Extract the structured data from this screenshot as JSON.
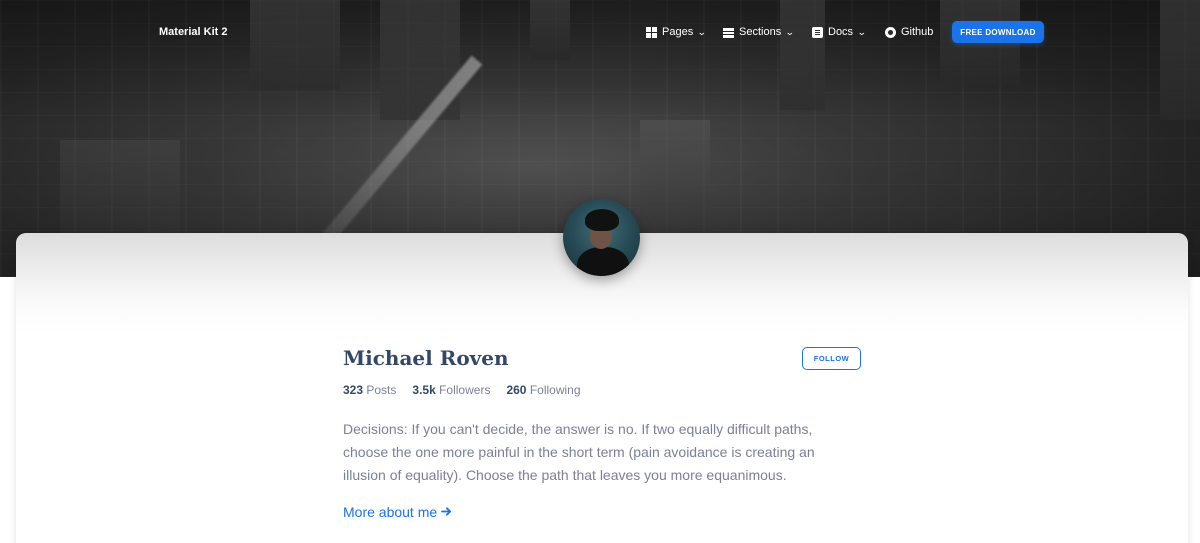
{
  "navbar": {
    "brand": "Material Kit 2",
    "items": [
      {
        "label": "Pages",
        "icon": "dashboard-icon",
        "has_dropdown": true
      },
      {
        "label": "Sections",
        "icon": "view-day-icon",
        "has_dropdown": true
      },
      {
        "label": "Docs",
        "icon": "article-icon",
        "has_dropdown": true
      },
      {
        "label": "Github",
        "icon": "github-icon",
        "has_dropdown": false
      }
    ],
    "cta_label": "FREE DOWNLOAD"
  },
  "profile": {
    "name": "Michael Roven",
    "follow_label": "FOLLOW",
    "stats": [
      {
        "value": "323",
        "label": "Posts"
      },
      {
        "value": "3.5k",
        "label": "Followers"
      },
      {
        "value": "260",
        "label": "Following"
      }
    ],
    "bio": "Decisions: If you can't decide, the answer is no. If two equally difficult paths, choose the one more painful in the short term (pain avoidance is creating an illusion of equality). Choose the path that leaves you more equanimous.",
    "more_link": "More about me",
    "more_icon": "arrow-right-icon"
  },
  "colors": {
    "primary": "#1a73e8",
    "heading": "#344767",
    "text_muted": "#7b809a"
  }
}
